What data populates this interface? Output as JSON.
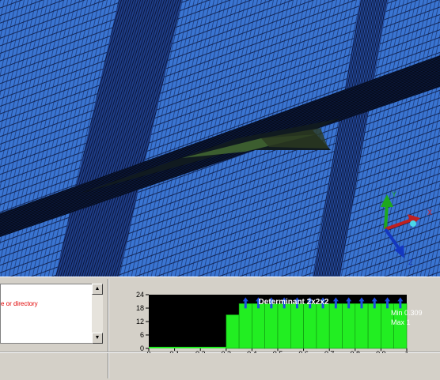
{
  "message_panel": {
    "text": "e or directory"
  },
  "icons": {
    "scroll_up": "scroll-up-arrow",
    "scroll_down": "scroll-down-arrow"
  },
  "triad": {
    "y_label": "Y",
    "x_label": "X",
    "z_label": "Z"
  },
  "colors": {
    "viewport_bg": "#3a75d2",
    "bar_fill": "#22ee22",
    "chart_bg": "#000000",
    "message_text": "#e00000"
  },
  "chart_data": {
    "type": "bar",
    "title": "Determinant 2x2x2",
    "annotations": [
      "Min 0.309",
      "Max 1"
    ],
    "x": [
      0.3,
      0.35,
      0.4,
      0.45,
      0.5,
      0.55,
      0.6,
      0.65,
      0.7,
      0.75,
      0.8,
      0.85,
      0.9,
      0.95
    ],
    "values": [
      15,
      20,
      20,
      20,
      20,
      20,
      20,
      20,
      20,
      20,
      20,
      20,
      20,
      20
    ],
    "overflow_marks": [
      false,
      true,
      true,
      true,
      true,
      true,
      true,
      true,
      true,
      true,
      true,
      true,
      true,
      true
    ],
    "bin_width": 0.05,
    "xlim": [
      0,
      1
    ],
    "ylim": [
      0,
      24
    ],
    "xticks": [
      "0",
      "0.1",
      "0.2",
      "0.3",
      "0.4",
      "0.5",
      "0.6",
      "0.7",
      "0.8",
      "0.9",
      "1"
    ],
    "yticks": [
      "0",
      "6",
      "12",
      "18",
      "24"
    ],
    "grid": false
  }
}
